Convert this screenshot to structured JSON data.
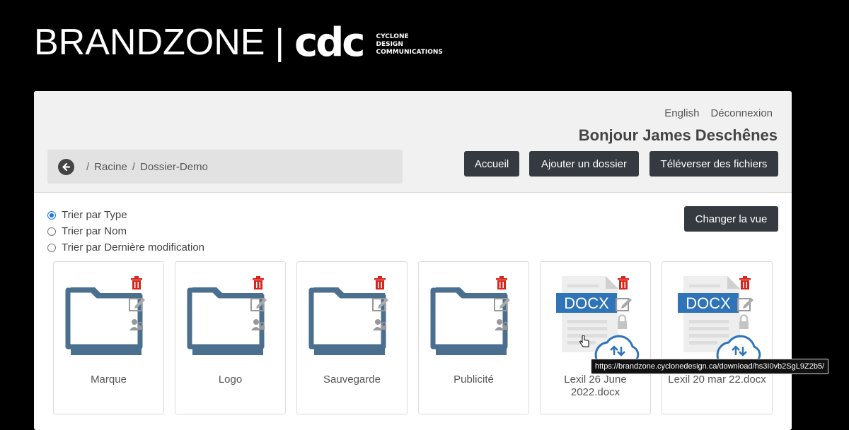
{
  "brand": {
    "name": "BRANDZONE",
    "separator": "|",
    "logo": "cdc",
    "tagline_1": "CYCLONE",
    "tagline_2": "DESIGN",
    "tagline_3": "COMMUNICATIONS"
  },
  "header": {
    "lang_link": "English",
    "logout_link": "Déconnexion",
    "greeting": "Bonjour James Deschênes"
  },
  "breadcrumb": {
    "items": [
      "Racine",
      "Dossier-Demo"
    ],
    "separator": "/"
  },
  "buttons": {
    "home": "Accueil",
    "add_folder": "Ajouter un dossier",
    "upload": "Téléverser des fichiers",
    "change_view": "Changer la vue"
  },
  "sort": {
    "options": [
      "Trier par Type",
      "Trier par Nom",
      "Trier par Dernière modification"
    ],
    "selected": "Trier par Type"
  },
  "items": [
    {
      "name": "Marque",
      "type": "folder"
    },
    {
      "name": "Logo",
      "type": "folder"
    },
    {
      "name": "Sauvegarde",
      "type": "folder"
    },
    {
      "name": "Publicité",
      "type": "folder"
    },
    {
      "name": "Lexil 26 June 2022.docx",
      "type": "docx",
      "badge": "DOCX"
    },
    {
      "name": "Lexil 20 mar 22.docx",
      "type": "docx",
      "badge": "DOCX"
    }
  ],
  "tooltip": "https://brandzone.cyclonedesign.ca/download/hs3I0vb2SgL9Z2b5/",
  "colors": {
    "folder_dark": "#4a6f8f",
    "folder_light": "#5bbbe6",
    "trash": "#d9251c",
    "button_bg": "#343a40",
    "radio_on": "#1a73e8"
  }
}
